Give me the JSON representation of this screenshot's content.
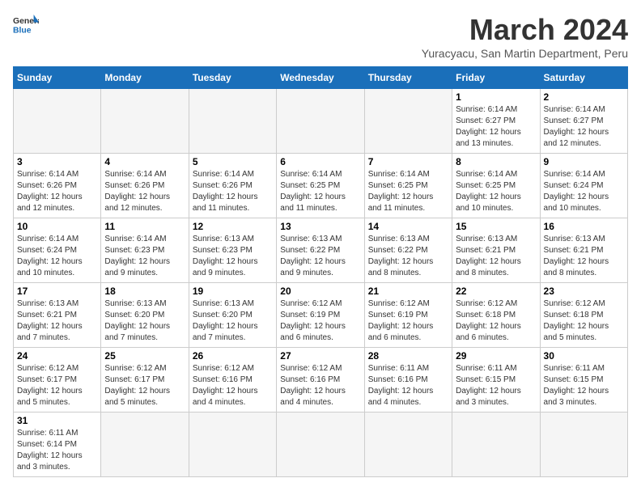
{
  "header": {
    "logo_general": "General",
    "logo_blue": "Blue",
    "month_year": "March 2024",
    "location": "Yuracyacu, San Martin Department, Peru"
  },
  "days_of_week": [
    "Sunday",
    "Monday",
    "Tuesday",
    "Wednesday",
    "Thursday",
    "Friday",
    "Saturday"
  ],
  "weeks": [
    [
      {
        "day": "",
        "info": "",
        "empty": true
      },
      {
        "day": "",
        "info": "",
        "empty": true
      },
      {
        "day": "",
        "info": "",
        "empty": true
      },
      {
        "day": "",
        "info": "",
        "empty": true
      },
      {
        "day": "",
        "info": "",
        "empty": true
      },
      {
        "day": "1",
        "info": "Sunrise: 6:14 AM\nSunset: 6:27 PM\nDaylight: 12 hours and 13 minutes.",
        "empty": false
      },
      {
        "day": "2",
        "info": "Sunrise: 6:14 AM\nSunset: 6:27 PM\nDaylight: 12 hours and 12 minutes.",
        "empty": false
      }
    ],
    [
      {
        "day": "3",
        "info": "Sunrise: 6:14 AM\nSunset: 6:26 PM\nDaylight: 12 hours and 12 minutes.",
        "empty": false
      },
      {
        "day": "4",
        "info": "Sunrise: 6:14 AM\nSunset: 6:26 PM\nDaylight: 12 hours and 12 minutes.",
        "empty": false
      },
      {
        "day": "5",
        "info": "Sunrise: 6:14 AM\nSunset: 6:26 PM\nDaylight: 12 hours and 11 minutes.",
        "empty": false
      },
      {
        "day": "6",
        "info": "Sunrise: 6:14 AM\nSunset: 6:25 PM\nDaylight: 12 hours and 11 minutes.",
        "empty": false
      },
      {
        "day": "7",
        "info": "Sunrise: 6:14 AM\nSunset: 6:25 PM\nDaylight: 12 hours and 11 minutes.",
        "empty": false
      },
      {
        "day": "8",
        "info": "Sunrise: 6:14 AM\nSunset: 6:25 PM\nDaylight: 12 hours and 10 minutes.",
        "empty": false
      },
      {
        "day": "9",
        "info": "Sunrise: 6:14 AM\nSunset: 6:24 PM\nDaylight: 12 hours and 10 minutes.",
        "empty": false
      }
    ],
    [
      {
        "day": "10",
        "info": "Sunrise: 6:14 AM\nSunset: 6:24 PM\nDaylight: 12 hours and 10 minutes.",
        "empty": false
      },
      {
        "day": "11",
        "info": "Sunrise: 6:14 AM\nSunset: 6:23 PM\nDaylight: 12 hours and 9 minutes.",
        "empty": false
      },
      {
        "day": "12",
        "info": "Sunrise: 6:13 AM\nSunset: 6:23 PM\nDaylight: 12 hours and 9 minutes.",
        "empty": false
      },
      {
        "day": "13",
        "info": "Sunrise: 6:13 AM\nSunset: 6:22 PM\nDaylight: 12 hours and 9 minutes.",
        "empty": false
      },
      {
        "day": "14",
        "info": "Sunrise: 6:13 AM\nSunset: 6:22 PM\nDaylight: 12 hours and 8 minutes.",
        "empty": false
      },
      {
        "day": "15",
        "info": "Sunrise: 6:13 AM\nSunset: 6:21 PM\nDaylight: 12 hours and 8 minutes.",
        "empty": false
      },
      {
        "day": "16",
        "info": "Sunrise: 6:13 AM\nSunset: 6:21 PM\nDaylight: 12 hours and 8 minutes.",
        "empty": false
      }
    ],
    [
      {
        "day": "17",
        "info": "Sunrise: 6:13 AM\nSunset: 6:21 PM\nDaylight: 12 hours and 7 minutes.",
        "empty": false
      },
      {
        "day": "18",
        "info": "Sunrise: 6:13 AM\nSunset: 6:20 PM\nDaylight: 12 hours and 7 minutes.",
        "empty": false
      },
      {
        "day": "19",
        "info": "Sunrise: 6:13 AM\nSunset: 6:20 PM\nDaylight: 12 hours and 7 minutes.",
        "empty": false
      },
      {
        "day": "20",
        "info": "Sunrise: 6:12 AM\nSunset: 6:19 PM\nDaylight: 12 hours and 6 minutes.",
        "empty": false
      },
      {
        "day": "21",
        "info": "Sunrise: 6:12 AM\nSunset: 6:19 PM\nDaylight: 12 hours and 6 minutes.",
        "empty": false
      },
      {
        "day": "22",
        "info": "Sunrise: 6:12 AM\nSunset: 6:18 PM\nDaylight: 12 hours and 6 minutes.",
        "empty": false
      },
      {
        "day": "23",
        "info": "Sunrise: 6:12 AM\nSunset: 6:18 PM\nDaylight: 12 hours and 5 minutes.",
        "empty": false
      }
    ],
    [
      {
        "day": "24",
        "info": "Sunrise: 6:12 AM\nSunset: 6:17 PM\nDaylight: 12 hours and 5 minutes.",
        "empty": false
      },
      {
        "day": "25",
        "info": "Sunrise: 6:12 AM\nSunset: 6:17 PM\nDaylight: 12 hours and 5 minutes.",
        "empty": false
      },
      {
        "day": "26",
        "info": "Sunrise: 6:12 AM\nSunset: 6:16 PM\nDaylight: 12 hours and 4 minutes.",
        "empty": false
      },
      {
        "day": "27",
        "info": "Sunrise: 6:12 AM\nSunset: 6:16 PM\nDaylight: 12 hours and 4 minutes.",
        "empty": false
      },
      {
        "day": "28",
        "info": "Sunrise: 6:11 AM\nSunset: 6:16 PM\nDaylight: 12 hours and 4 minutes.",
        "empty": false
      },
      {
        "day": "29",
        "info": "Sunrise: 6:11 AM\nSunset: 6:15 PM\nDaylight: 12 hours and 3 minutes.",
        "empty": false
      },
      {
        "day": "30",
        "info": "Sunrise: 6:11 AM\nSunset: 6:15 PM\nDaylight: 12 hours and 3 minutes.",
        "empty": false
      }
    ],
    [
      {
        "day": "31",
        "info": "Sunrise: 6:11 AM\nSunset: 6:14 PM\nDaylight: 12 hours and 3 minutes.",
        "empty": false
      },
      {
        "day": "",
        "info": "",
        "empty": true
      },
      {
        "day": "",
        "info": "",
        "empty": true
      },
      {
        "day": "",
        "info": "",
        "empty": true
      },
      {
        "day": "",
        "info": "",
        "empty": true
      },
      {
        "day": "",
        "info": "",
        "empty": true
      },
      {
        "day": "",
        "info": "",
        "empty": true
      }
    ]
  ]
}
